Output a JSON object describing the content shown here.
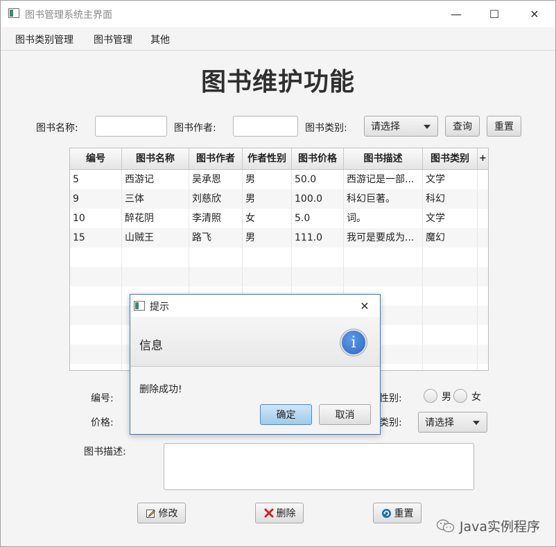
{
  "window": {
    "title": "图书管理系统主界面",
    "minimize_glyph": "—",
    "maximize_glyph": "☐",
    "close_glyph": "✕"
  },
  "menu": [
    "图书类别管理",
    "图书管理",
    "其他"
  ],
  "page_title": "图书维护功能",
  "search": {
    "name_label": "图书名称:",
    "author_label": "图书作者:",
    "type_label": "图书类别:",
    "type_value": "请选择",
    "query_button": "查询",
    "reset_button": "重置"
  },
  "table": {
    "columns": [
      "编号",
      "图书名称",
      "图书作者",
      "作者性别",
      "图书价格",
      "图书描述",
      "图书类别"
    ],
    "menu_glyph": "+",
    "rows": [
      [
        "5",
        "西游记",
        "吴承恩",
        "男",
        "50.0",
        "西游记是一部...",
        "文学"
      ],
      [
        "9",
        "三体",
        "刘慈欣",
        "男",
        "100.0",
        "科幻巨著。",
        "科幻"
      ],
      [
        "10",
        "醉花阴",
        "李清照",
        "女",
        "5.0",
        "词。",
        "文学"
      ],
      [
        "15",
        "山贼王",
        "路飞",
        "男",
        "111.0",
        "我可是要成为...",
        "魔幻"
      ]
    ]
  },
  "form": {
    "id_label": "编号:",
    "price_label": "价格:",
    "gender_label": "性别:",
    "male": "男",
    "female": "女",
    "type_label": "类别:",
    "type_value": "请选择",
    "desc_label": "图书描述:"
  },
  "actions": {
    "modify": "修改",
    "delete": "删除",
    "reset": "重置"
  },
  "dialog": {
    "title": "提示",
    "header": "信息",
    "message": "删除成功!",
    "ok": "确定",
    "cancel": "取消",
    "info_glyph": "i"
  },
  "watermark": "Java实例程序"
}
